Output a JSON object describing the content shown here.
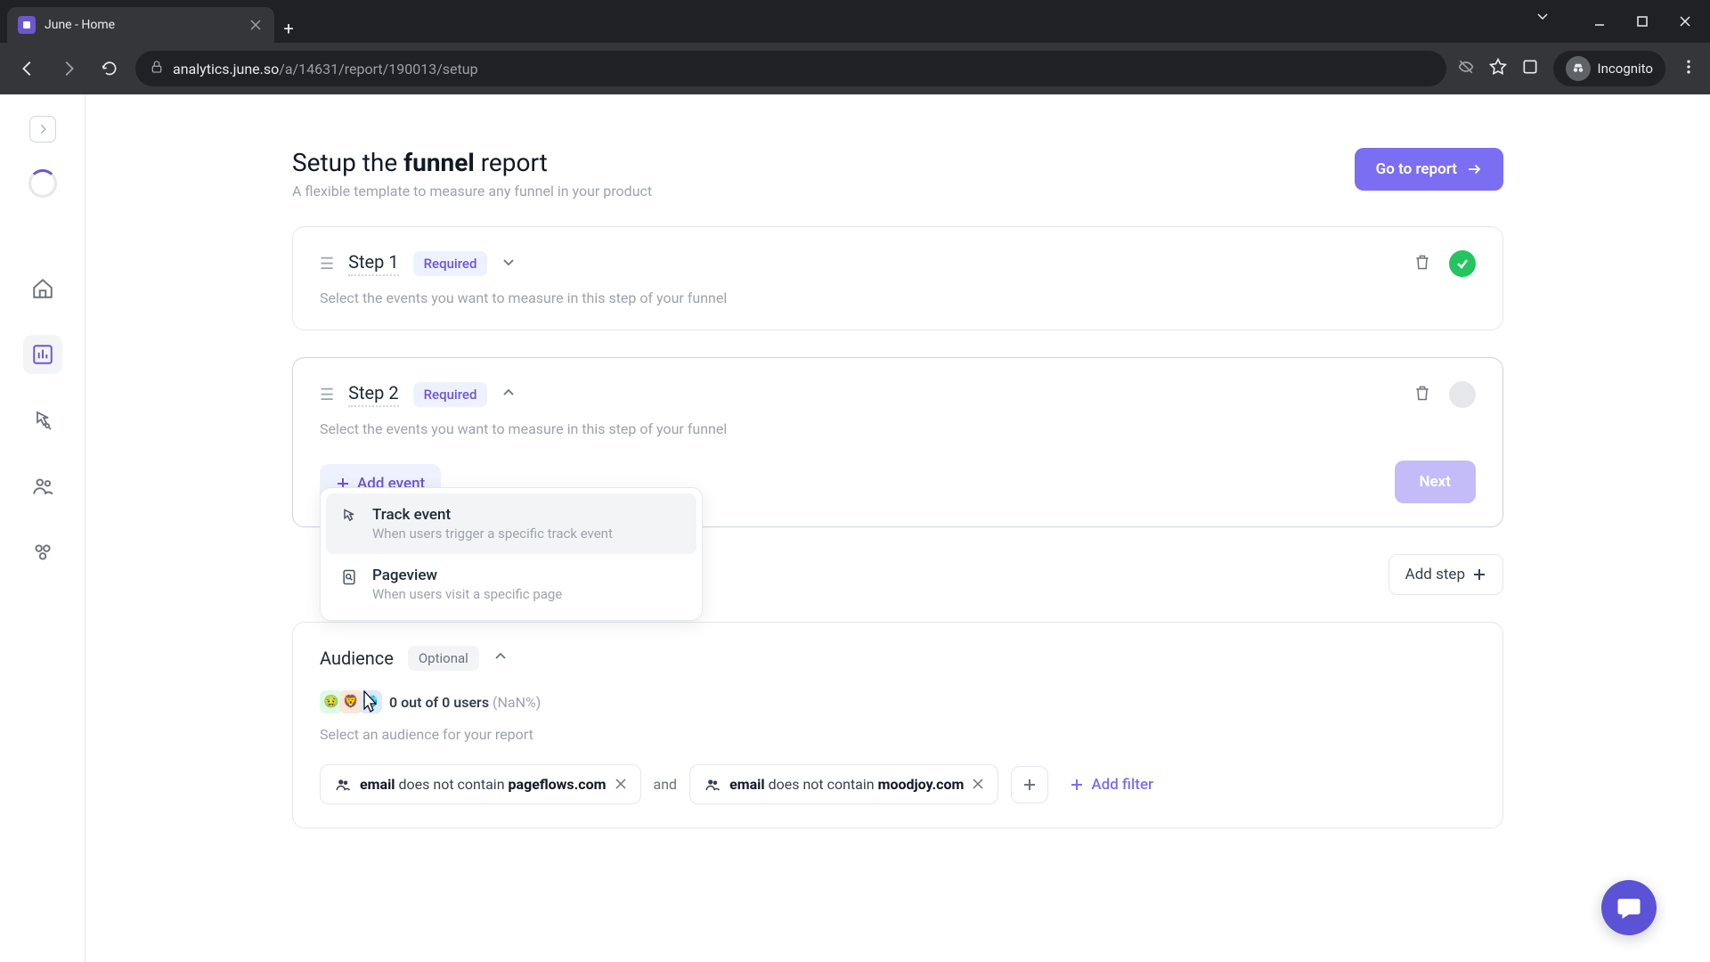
{
  "browser": {
    "tab_title": "June - Home",
    "url_domain": "analytics.june.so",
    "url_path": "/a/14631/report/190013/setup",
    "incognito_label": "Incognito"
  },
  "header": {
    "title_prefix": "Setup the ",
    "title_bold": "funnel",
    "title_suffix": " report",
    "subtitle": "A flexible template to measure any funnel in your product",
    "go_button": "Go to report"
  },
  "steps": [
    {
      "name": "Step 1",
      "required": "Required",
      "desc": "Select the events you want to measure in this step of your funnel",
      "done": true,
      "expanded": false
    },
    {
      "name": "Step 2",
      "required": "Required",
      "desc": "Select the events you want to measure in this step of your funnel",
      "done": false,
      "expanded": true
    }
  ],
  "add_event_label": "Add event",
  "next_label": "Next",
  "dropdown": {
    "items": [
      {
        "title": "Track event",
        "desc": "When users trigger a specific track event"
      },
      {
        "title": "Pageview",
        "desc": "When users visit a specific page"
      }
    ]
  },
  "add_step_label": "Add step",
  "audience": {
    "title": "Audience",
    "optional": "Optional",
    "count_text": "0 out of 0 users",
    "pct": "(NaN%)",
    "desc": "Select an audience for your report",
    "avatars": [
      "🤢",
      "🦁",
      "🥶"
    ]
  },
  "filters": {
    "items": [
      {
        "field": "email",
        "op": "does not contain",
        "value": "pageflows.com"
      },
      {
        "field": "email",
        "op": "does not contain",
        "value": "moodjoy.com"
      }
    ],
    "joiner": "and",
    "add_label": "Add filter"
  }
}
